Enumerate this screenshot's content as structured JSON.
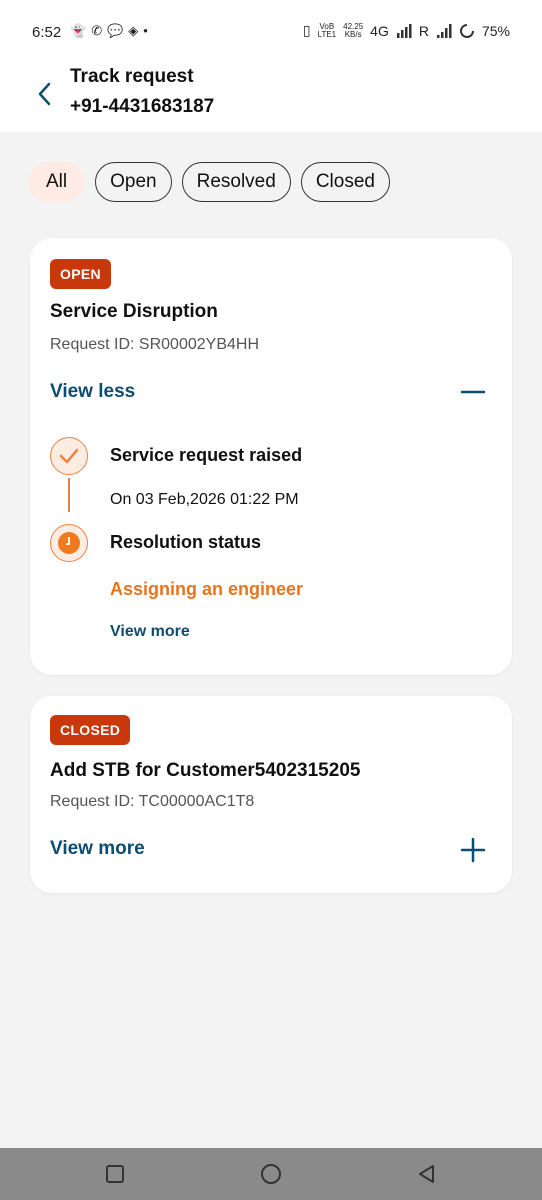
{
  "status_bar": {
    "time": "6:52",
    "left_dot": "•",
    "volte_top": "VoB",
    "volte_bottom": "LTE1",
    "speed_top": "42.25",
    "speed_bottom": "KB/s",
    "network": "4G",
    "roaming": "R",
    "battery": "75%"
  },
  "header": {
    "title": "Track request",
    "subtitle": "+91-4431683187"
  },
  "filters": [
    {
      "label": "All",
      "active": true
    },
    {
      "label": "Open",
      "active": false
    },
    {
      "label": "Resolved",
      "active": false
    },
    {
      "label": "Closed",
      "active": false
    }
  ],
  "cards": [
    {
      "status": "OPEN",
      "title": "Service Disruption",
      "request_id": "Request ID: SR00002YB4HH",
      "toggle_label": "View less",
      "timeline": {
        "step1_title": "Service request raised",
        "step1_date": "On 03 Feb,2026 01:22 PM",
        "step2_title": "Resolution status",
        "step2_status": "Assigning an engineer",
        "view_more": "View more"
      }
    },
    {
      "status": "CLOSED",
      "title": "Add STB for Customer5402315205",
      "request_id": "Request ID: TC00000AC1T8",
      "toggle_label": "View more"
    }
  ],
  "colors": {
    "accent_blue": "#0d4d70",
    "badge": "#c9380b",
    "orange": "#e8741e",
    "chip_active_bg": "#fdebe4"
  }
}
